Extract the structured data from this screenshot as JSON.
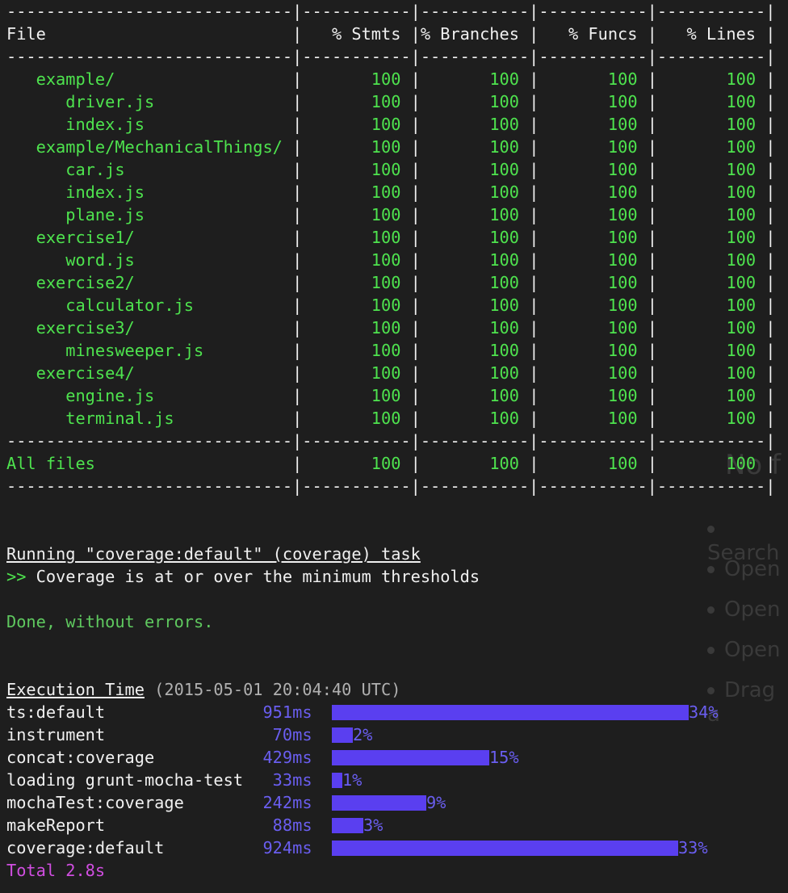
{
  "table": {
    "separator": "-----------------------------|-----------|-----------|-----------|-----------|",
    "header": {
      "file": "File",
      "stmts": "% Stmts",
      "branches": "% Branches",
      "funcs": "% Funcs",
      "lines": "% Lines"
    },
    "rows": [
      {
        "name": "example/",
        "indent": 1,
        "stmts": "100",
        "branches": "100",
        "funcs": "100",
        "lines": "100"
      },
      {
        "name": "driver.js",
        "indent": 2,
        "stmts": "100",
        "branches": "100",
        "funcs": "100",
        "lines": "100"
      },
      {
        "name": "index.js",
        "indent": 2,
        "stmts": "100",
        "branches": "100",
        "funcs": "100",
        "lines": "100"
      },
      {
        "name": "example/MechanicalThings/",
        "indent": 1,
        "stmts": "100",
        "branches": "100",
        "funcs": "100",
        "lines": "100"
      },
      {
        "name": "car.js",
        "indent": 2,
        "stmts": "100",
        "branches": "100",
        "funcs": "100",
        "lines": "100"
      },
      {
        "name": "index.js",
        "indent": 2,
        "stmts": "100",
        "branches": "100",
        "funcs": "100",
        "lines": "100"
      },
      {
        "name": "plane.js",
        "indent": 2,
        "stmts": "100",
        "branches": "100",
        "funcs": "100",
        "lines": "100"
      },
      {
        "name": "exercise1/",
        "indent": 1,
        "stmts": "100",
        "branches": "100",
        "funcs": "100",
        "lines": "100"
      },
      {
        "name": "word.js",
        "indent": 2,
        "stmts": "100",
        "branches": "100",
        "funcs": "100",
        "lines": "100"
      },
      {
        "name": "exercise2/",
        "indent": 1,
        "stmts": "100",
        "branches": "100",
        "funcs": "100",
        "lines": "100"
      },
      {
        "name": "calculator.js",
        "indent": 2,
        "stmts": "100",
        "branches": "100",
        "funcs": "100",
        "lines": "100"
      },
      {
        "name": "exercise3/",
        "indent": 1,
        "stmts": "100",
        "branches": "100",
        "funcs": "100",
        "lines": "100"
      },
      {
        "name": "minesweeper.js",
        "indent": 2,
        "stmts": "100",
        "branches": "100",
        "funcs": "100",
        "lines": "100"
      },
      {
        "name": "exercise4/",
        "indent": 1,
        "stmts": "100",
        "branches": "100",
        "funcs": "100",
        "lines": "100"
      },
      {
        "name": "engine.js",
        "indent": 2,
        "stmts": "100",
        "branches": "100",
        "funcs": "100",
        "lines": "100"
      },
      {
        "name": "terminal.js",
        "indent": 2,
        "stmts": "100",
        "branches": "100",
        "funcs": "100",
        "lines": "100"
      }
    ],
    "total": {
      "name": "All files",
      "stmts": "100",
      "branches": "100",
      "funcs": "100",
      "lines": "100"
    }
  },
  "task": {
    "running": "Running \"coverage:default\" (coverage) task",
    "prompt": ">>",
    "message": "Coverage is at or over the minimum thresholds",
    "done": "Done, without errors."
  },
  "timing": {
    "title": "Execution Time",
    "timestamp": "(2015-05-01 20:04:40 UTC)",
    "tasks": [
      {
        "name": "ts:default",
        "time": "951ms",
        "percent": "34%",
        "fraction": 0.34
      },
      {
        "name": "instrument",
        "time": "70ms",
        "percent": "2%",
        "fraction": 0.02
      },
      {
        "name": "concat:coverage",
        "time": "429ms",
        "percent": "15%",
        "fraction": 0.15
      },
      {
        "name": "loading grunt-mocha-test",
        "time": "33ms",
        "percent": "1%",
        "fraction": 0.01
      },
      {
        "name": "mochaTest:coverage",
        "time": "242ms",
        "percent": "9%",
        "fraction": 0.09
      },
      {
        "name": "makeReport",
        "time": "88ms",
        "percent": "3%",
        "fraction": 0.03
      },
      {
        "name": "coverage:default",
        "time": "924ms",
        "percent": "33%",
        "fraction": 0.33
      }
    ],
    "total": "Total 2.8s"
  },
  "background_page": {
    "heading": "No f",
    "bullets": [
      "Search",
      "Open",
      "Open",
      "Open",
      "Drag a"
    ]
  },
  "colors": {
    "background": "#1e1e1e",
    "green": "#4ee34e",
    "bar": "#5a3ff0",
    "percent_text": "#6a5ef0",
    "total": "#d04ee0"
  }
}
